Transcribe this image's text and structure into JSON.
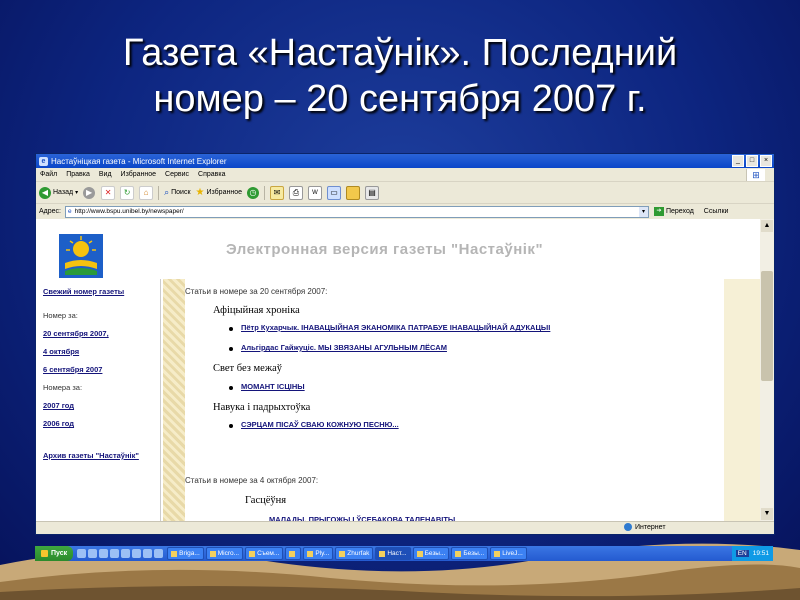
{
  "slide": {
    "title_line1": "Газета «Настаўнік». Последний",
    "title_line2": "номер – 20 сентября 2007 г."
  },
  "browser": {
    "window_title": "Настаўніцкая газета - Microsoft Internet Explorer",
    "menu": [
      "Файл",
      "Правка",
      "Вид",
      "Избранное",
      "Сервис",
      "Справка"
    ],
    "toolbar": {
      "back": "Назад",
      "search": "Поиск",
      "favorites": "Избранное"
    },
    "address_label": "Адрес:",
    "url": "http://www.bspu.unibel.by/newspaper/",
    "go_label": "Переход",
    "links_label": "Ссылки",
    "status_zone": "Интернет"
  },
  "page": {
    "banner": "Электронная версия газеты \"Настаўнік\"",
    "nav": {
      "fresh": "Свежий номер газеты",
      "number_label": "Номер за:",
      "issues": [
        "20 сентября 2007,",
        "4 октября",
        "6 сентября 2007"
      ],
      "numbers_label": "Номера за:",
      "years": [
        "2007 год",
        "2006 год"
      ],
      "archive": "Архив газеты \"Настаўнік\""
    },
    "issue1": {
      "heading": "Статьи в номере за 20 сентября 2007:",
      "sections": [
        {
          "title": "Афіцыйная хроніка",
          "articles": [
            "Пётр Кухарчык. ІНАВАЦЫЙНАЯ ЭКАНОМІКА ПАТРАБУЕ ІНАВАЦЫЙНАЙ АДУКАЦЫІ",
            "Альгірдас Гайжуціс. МЫ ЗВЯЗАНЫ АГУЛЬНЫМ ЛЁСАМ"
          ]
        },
        {
          "title": "Свет без межаў",
          "articles": [
            "МОМАНТ ІСЦІНЫ"
          ]
        },
        {
          "title": "Навука і падрыхтоўка",
          "articles": [
            "СЭРЦАМ ПІСАЎ СВАЮ КОЖНУЮ ПЕСНЮ..."
          ]
        }
      ]
    },
    "issue2": {
      "heading": "Статьи в номере за 4 октября 2007:",
      "section": "Гасцёўня",
      "article_partial": "МАЛАДЫ, ПРЫГОЖЫ І ЎСЕБАКОВА ТАЛЕНАВІТЫ"
    }
  },
  "taskbar": {
    "start": "Пуск",
    "tasks": [
      "Briga...",
      "Micro...",
      "Съем...",
      "",
      "Ply...",
      "Zhurfak",
      "Наст...",
      "Безы...",
      "Безы...",
      "LiveJ..."
    ],
    "lang": "EN",
    "clock": "19:51"
  }
}
